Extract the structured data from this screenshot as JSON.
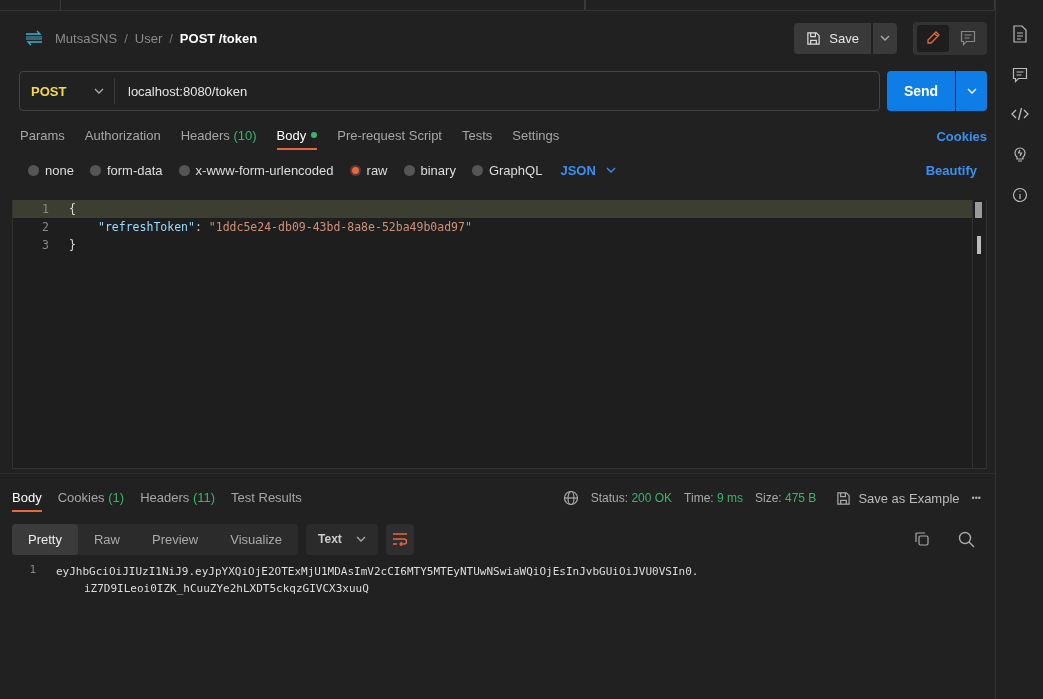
{
  "breadcrumb": {
    "separator": "/",
    "items": [
      "MutsaSNS",
      "User",
      "POST /token"
    ]
  },
  "save_button": "Save",
  "modes": [
    {
      "kind": "edit",
      "selected": true
    },
    {
      "kind": "comment",
      "selected": false
    }
  ],
  "request": {
    "method": "POST",
    "url": "localhost:8080/token",
    "send_button": "Send"
  },
  "request_tabs": [
    {
      "label": "Params",
      "selected": false
    },
    {
      "label": "Authorization",
      "selected": false
    },
    {
      "label": "Headers",
      "count": "(10)",
      "selected": false
    },
    {
      "label": "Body",
      "selected": true,
      "dot": true
    },
    {
      "label": "Pre-request Script",
      "selected": false
    },
    {
      "label": "Tests",
      "selected": false
    },
    {
      "label": "Settings",
      "selected": false
    }
  ],
  "cookies_link": "Cookies",
  "body_types": [
    {
      "label": "none",
      "selected": false
    },
    {
      "label": "form-data",
      "selected": false
    },
    {
      "label": "x-www-form-urlencoded",
      "selected": false
    },
    {
      "label": "raw",
      "selected": true
    },
    {
      "label": "binary",
      "selected": false
    },
    {
      "label": "GraphQL",
      "selected": false
    }
  ],
  "body_format": "JSON",
  "beautify_link": "Beautify",
  "editor_lines": [
    {
      "number": "1",
      "highlighted": true,
      "tokens": [
        {
          "kind": "brace",
          "text": "{"
        }
      ]
    },
    {
      "number": "2",
      "highlighted": false,
      "indented": true,
      "tokens": [
        {
          "kind": "key",
          "text": "\"refreshToken\""
        },
        {
          "kind": "punct",
          "text": ": "
        },
        {
          "kind": "string",
          "text": "\"1ddc5e24-db09-43bd-8a8e-52ba49b0ad97\""
        }
      ]
    },
    {
      "number": "3",
      "highlighted": false,
      "tokens": [
        {
          "kind": "brace",
          "text": "}"
        }
      ]
    }
  ],
  "response_tabs": [
    {
      "label": "Body",
      "selected": true
    },
    {
      "label": "Cookies",
      "count": "(1)",
      "selected": false
    },
    {
      "label": "Headers",
      "count": "(11)",
      "selected": false
    },
    {
      "label": "Test Results",
      "selected": false
    }
  ],
  "status": [
    {
      "label": "Status:",
      "value": "200 OK"
    },
    {
      "label": "Time:",
      "value": "9 ms"
    },
    {
      "label": "Size:",
      "value": "475 B"
    }
  ],
  "save_example": "Save as Example",
  "more_button": "•••",
  "view_tabs": [
    {
      "label": "Pretty",
      "selected": true
    },
    {
      "label": "Raw",
      "selected": false
    },
    {
      "label": "Preview",
      "selected": false
    },
    {
      "label": "Visualize",
      "selected": false
    }
  ],
  "response_format": "Text",
  "response_lines": [
    {
      "number": "1",
      "segments": [
        "eyJhbGciOiJIUzI1NiJ9.eyJpYXQiOjE2OTExMjU1MDAsImV2cCI6MTY5MTEyNTUwNSwiaWQiOjEsInJvbGUiOiJVU0VSIn0.",
        "iZ7D9ILeoi0IZK_hCuuZYe2hLXDT5ckqzGIVCX3xuuQ"
      ]
    }
  ]
}
